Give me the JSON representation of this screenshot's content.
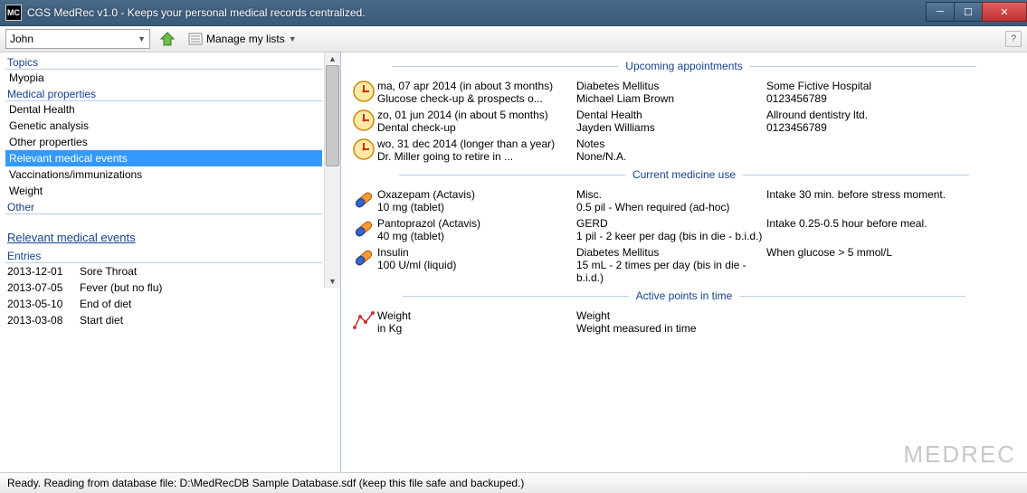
{
  "window": {
    "title": "CGS MedRec v1.0 - Keeps your personal medical records centralized.",
    "icon_text": "MC"
  },
  "toolbar": {
    "user_selected": "John",
    "manage_lists_label": "Manage my lists"
  },
  "sidebar": {
    "section_topics": "Topics",
    "topics": [
      "Myopia"
    ],
    "section_medprops": "Medical properties",
    "medprops": [
      "Dental Health",
      "Genetic analysis",
      "Other properties",
      "Relevant medical events",
      "Vaccinations/immunizations",
      "Weight"
    ],
    "section_other": "Other",
    "selected_index": 3,
    "detail_title": "Relevant medical events",
    "section_entries": "Entries",
    "entries": [
      {
        "date": "2013-12-01",
        "text": "Sore Throat"
      },
      {
        "date": "2013-07-05",
        "text": "Fever (but no flu)"
      },
      {
        "date": "2013-05-10",
        "text": "End of diet"
      },
      {
        "date": "2013-03-08",
        "text": "Start diet"
      }
    ]
  },
  "panels": {
    "appointments": {
      "title": "Upcoming appointments",
      "rows": [
        {
          "line1": "ma, 07 apr 2014 (in about 3 months)",
          "line2": "Glucose check-up & prospects o...",
          "cat": "Diabetes Mellitus",
          "who": "Michael Liam Brown",
          "loc": "Some Fictive Hospital",
          "phone": "0123456789"
        },
        {
          "line1": "zo, 01 jun 2014 (in about 5 months)",
          "line2": "Dental check-up",
          "cat": "Dental Health",
          "who": "Jayden Williams",
          "loc": "Allround dentistry ltd.",
          "phone": "0123456789"
        },
        {
          "line1": "wo, 31 dec 2014 (longer than a year)",
          "line2": "Dr. Miller going to retire in ...",
          "cat": "Notes",
          "who": "None/N.A.",
          "loc": "",
          "phone": ""
        }
      ]
    },
    "medicine": {
      "title": "Current medicine use",
      "rows": [
        {
          "name": "Oxazepam (Actavis)",
          "dose": "10 mg (tablet)",
          "cat": "Misc.",
          "freq": "0.5 pil - When required (ad-hoc)",
          "note": "Intake 30 min. before stress moment."
        },
        {
          "name": "Pantoprazol (Actavis)",
          "dose": "40 mg (tablet)",
          "cat": "GERD",
          "freq": "1 pil - 2 keer per dag (bis in die - b.i.d.)",
          "note": "Intake 0.25-0.5 hour before meal."
        },
        {
          "name": "Insulin",
          "dose": "100 U/ml (liquid)",
          "cat": "Diabetes Mellitus",
          "freq": "15 mL - 2 times per day (bis in die - b.i.d.)",
          "note": "When glucose > 5 mmol/L"
        }
      ]
    },
    "points": {
      "title": "Active points in time",
      "rows": [
        {
          "name": "Weight",
          "unit": "in Kg",
          "cat": "Weight",
          "desc": "Weight measured in time"
        }
      ]
    }
  },
  "watermark": "MEDREC",
  "statusbar": "Ready. Reading from database file: D:\\MedRecDB Sample Database.sdf (keep this file safe and backuped.)"
}
